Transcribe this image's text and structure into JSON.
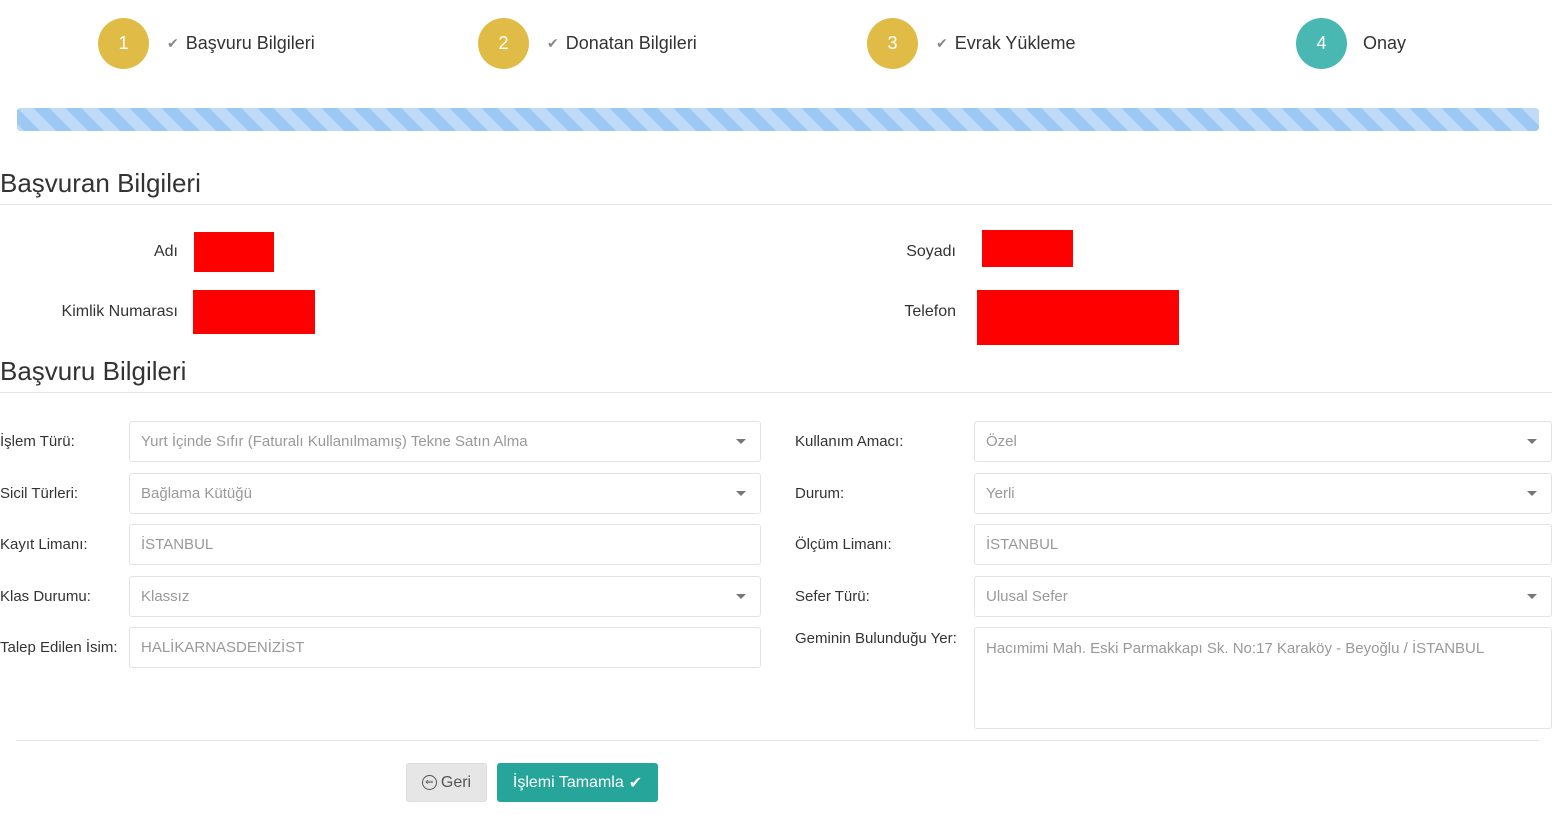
{
  "wizard": {
    "steps": [
      {
        "number": "1",
        "label": "Başvuru Bilgileri",
        "check": "✔"
      },
      {
        "number": "2",
        "label": "Donatan Bilgileri",
        "check": "✔"
      },
      {
        "number": "3",
        "label": "Evrak Yükleme",
        "check": "✔"
      },
      {
        "number": "4",
        "label": "Onay"
      }
    ],
    "progress_fraction": 1.0,
    "colors": {
      "done": "#e0bc47",
      "active": "#4ab8b2",
      "progress": "#9bc9f3"
    }
  },
  "applicant": {
    "title": "Başvuran Bilgileri",
    "first_name_label": "Adı",
    "last_name_label": "Soyadı",
    "id_number_label": "Kimlik Numarası",
    "phone_label": "Telefon"
  },
  "application": {
    "title": "Başvuru Bilgileri",
    "islem_turu": {
      "label": "İşlem Türü:",
      "value": "Yurt İçinde Sıfır (Faturalı Kullanılmamış) Tekne Satın Alma"
    },
    "kullanim_amaci": {
      "label": "Kullanım Amacı:",
      "value": "Özel"
    },
    "sicil_turleri": {
      "label": "Sicil Türleri:",
      "value": "Bağlama Kütüğü"
    },
    "durum": {
      "label": "Durum:",
      "value": "Yerli"
    },
    "kayit_limani": {
      "label": "Kayıt Limanı:",
      "value": "İSTANBUL"
    },
    "olcum_limani": {
      "label": "Ölçüm Limanı:",
      "value": "İSTANBUL"
    },
    "klas_durumu": {
      "label": "Klas Durumu:",
      "value": "Klassız"
    },
    "sefer_turu": {
      "label": "Sefer Türü:",
      "value": "Ulusal Sefer"
    },
    "talep_edilen_isim": {
      "label": "Talep Edilen İsim:",
      "value": "HALİKARNASDENİZİST"
    },
    "geminin_bulundugu_yer": {
      "label": "Geminin Bulunduğu Yer:",
      "value": "Hacımimi Mah. Eski Parmakkapı Sk. No:17 Karaköy - Beyoğlu / İSTANBUL"
    }
  },
  "actions": {
    "back_icon": "⇐",
    "back_label": "Geri",
    "complete_label": "İşlemi Tamamla",
    "complete_icon": "✔",
    "accent": "#26a69a"
  }
}
